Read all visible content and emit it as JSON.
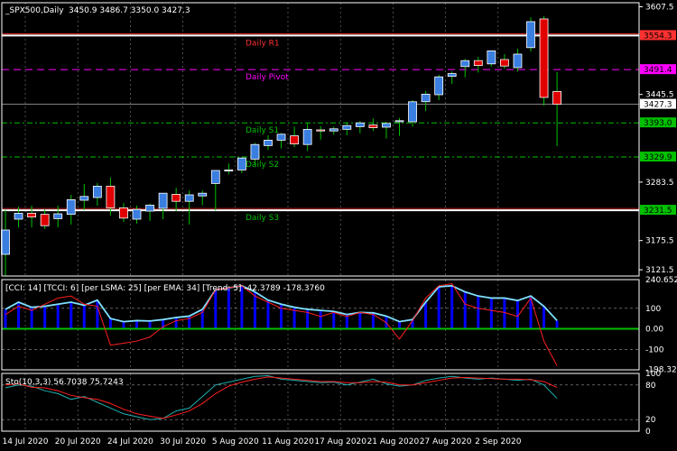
{
  "header": {
    "symbol": "_SPX500,Daily",
    "ohlc": "3450.9 3486.7 3350.0 3427.3"
  },
  "colors": {
    "background": "#000000",
    "grid": "#ffffff",
    "bull": "#3a7ee0",
    "bear": "#e00000",
    "wick": "#00c000",
    "pivot": "#ff00ff",
    "resistance": "#ff3030",
    "support": "#00c000",
    "cci_line": "#7fe0ff",
    "cci_hist": "#0000ff",
    "cci_base": "#00c000",
    "signal_red": "#ff2020",
    "stoch_main": "#1fb0b0",
    "stoch_signal": "#ff2020"
  },
  "chart_data": [
    {
      "type": "candlestick",
      "panel": "main",
      "ylim": [
        3110,
        3615
      ],
      "y_ticks": [
        "3607.5",
        "3445.5",
        "3283.5",
        "3175.5",
        "3121.5"
      ],
      "tick_values": [
        3607.5,
        3445.5,
        3283.5,
        3175.5,
        3121.5
      ],
      "x_labels": [
        "14 Jul 2020",
        "20 Jul 2020",
        "24 Jul 2020",
        "30 Jul 2020",
        "5 Aug 2020",
        "11 Aug 2020",
        "17 Aug 2020",
        "21 Aug 2020",
        "27 Aug 2020",
        "2 Sep 2020"
      ],
      "x_label_index": [
        0,
        4,
        8,
        12,
        16,
        20,
        24,
        28,
        32,
        36
      ],
      "candles": [
        {
          "o": 3150,
          "h": 3232,
          "l": 3110,
          "c": 3195
        },
        {
          "o": 3215,
          "h": 3238,
          "l": 3200,
          "c": 3226
        },
        {
          "o": 3226,
          "h": 3240,
          "l": 3200,
          "c": 3219
        },
        {
          "o": 3224,
          "h": 3233,
          "l": 3197,
          "c": 3203
        },
        {
          "o": 3216,
          "h": 3240,
          "l": 3200,
          "c": 3225
        },
        {
          "o": 3224,
          "h": 3260,
          "l": 3205,
          "c": 3251
        },
        {
          "o": 3250,
          "h": 3280,
          "l": 3232,
          "c": 3257
        },
        {
          "o": 3255,
          "h": 3282,
          "l": 3240,
          "c": 3276
        },
        {
          "o": 3276,
          "h": 3292,
          "l": 3222,
          "c": 3236
        },
        {
          "o": 3236,
          "h": 3245,
          "l": 3210,
          "c": 3217
        },
        {
          "o": 3215,
          "h": 3240,
          "l": 3207,
          "c": 3233
        },
        {
          "o": 3230,
          "h": 3244,
          "l": 3212,
          "c": 3241
        },
        {
          "o": 3235,
          "h": 3262,
          "l": 3215,
          "c": 3263
        },
        {
          "o": 3261,
          "h": 3273,
          "l": 3230,
          "c": 3248
        },
        {
          "o": 3248,
          "h": 3268,
          "l": 3205,
          "c": 3260
        },
        {
          "o": 3258,
          "h": 3268,
          "l": 3241,
          "c": 3263
        },
        {
          "o": 3281,
          "h": 3290,
          "l": 3231,
          "c": 3305
        },
        {
          "o": 3304,
          "h": 3318,
          "l": 3298,
          "c": 3306
        },
        {
          "o": 3306,
          "h": 3330,
          "l": 3300,
          "c": 3328
        },
        {
          "o": 3326,
          "h": 3356,
          "l": 3316,
          "c": 3353
        },
        {
          "o": 3351,
          "h": 3370,
          "l": 3343,
          "c": 3361
        },
        {
          "o": 3361,
          "h": 3374,
          "l": 3346,
          "c": 3372
        },
        {
          "o": 3369,
          "h": 3386,
          "l": 3348,
          "c": 3354
        },
        {
          "o": 3353,
          "h": 3393,
          "l": 3341,
          "c": 3381
        },
        {
          "o": 3380,
          "h": 3387,
          "l": 3362,
          "c": 3378
        },
        {
          "o": 3378,
          "h": 3386,
          "l": 3371,
          "c": 3382
        },
        {
          "o": 3381,
          "h": 3393,
          "l": 3370,
          "c": 3388
        },
        {
          "o": 3386,
          "h": 3396,
          "l": 3374,
          "c": 3393
        },
        {
          "o": 3389,
          "h": 3401,
          "l": 3378,
          "c": 3384
        },
        {
          "o": 3385,
          "h": 3395,
          "l": 3364,
          "c": 3392
        },
        {
          "o": 3395,
          "h": 3402,
          "l": 3369,
          "c": 3397
        },
        {
          "o": 3395,
          "h": 3435,
          "l": 3386,
          "c": 3432
        },
        {
          "o": 3432,
          "h": 3452,
          "l": 3415,
          "c": 3446
        },
        {
          "o": 3445,
          "h": 3482,
          "l": 3435,
          "c": 3478
        },
        {
          "o": 3479,
          "h": 3488,
          "l": 3465,
          "c": 3484
        },
        {
          "o": 3497,
          "h": 3511,
          "l": 3477,
          "c": 3508
        },
        {
          "o": 3508,
          "h": 3515,
          "l": 3486,
          "c": 3499
        },
        {
          "o": 3502,
          "h": 3527,
          "l": 3497,
          "c": 3526
        },
        {
          "o": 3510,
          "h": 3520,
          "l": 3493,
          "c": 3498
        },
        {
          "o": 3495,
          "h": 3530,
          "l": 3488,
          "c": 3520
        },
        {
          "o": 3532,
          "h": 3588,
          "l": 3525,
          "c": 3580
        },
        {
          "o": 3585,
          "h": 3590,
          "l": 3425,
          "c": 3440
        },
        {
          "o": 3450.9,
          "h": 3486.7,
          "l": 3350.0,
          "c": 3427.3
        }
      ],
      "levels": [
        {
          "name": "Daily R1",
          "value": 3554.3,
          "price_label": "3554.3",
          "style": "resistance"
        },
        {
          "name": "Daily Pivot",
          "value": 3491.4,
          "price_label": "3491.4",
          "style": "pivot"
        },
        {
          "name": "",
          "value": 3427.3,
          "price_label": "3427.3",
          "style": "current"
        },
        {
          "name": "Daily S1",
          "value": 3393.0,
          "price_label": "3393.0",
          "style": "support"
        },
        {
          "name": "Daily S2",
          "value": 3329.9,
          "price_label": "3329.9",
          "style": "support"
        },
        {
          "name": "Daily S3",
          "value": 3231.5,
          "price_label": "3231.5",
          "style": "support"
        }
      ]
    },
    {
      "type": "line",
      "panel": "cci",
      "title": "[CCI: 14] [TCCI: 6] [per LSMA: 25] [per EMA: 34] [Trend: 5] -42.3789 -178.3760",
      "ylim": [
        -200,
        240
      ],
      "y_ticks": [
        "240.6524",
        "100",
        "0.00",
        "-100",
        "-198.329"
      ],
      "tick_values": [
        240,
        100,
        0,
        -100,
        -198
      ],
      "series": [
        {
          "values": [
            95,
            130,
            105,
            110,
            120,
            130,
            115,
            140,
            50,
            35,
            40,
            38,
            45,
            55,
            62,
            95,
            190,
            200,
            210,
            180,
            140,
            120,
            105,
            95,
            90,
            85,
            70,
            80,
            78,
            62,
            35,
            45,
            130,
            205,
            210,
            180,
            160,
            150,
            150,
            138,
            160,
            110,
            40
          ]
        },
        {
          "values": [
            70,
            110,
            90,
            120,
            150,
            160,
            120,
            110,
            -80,
            -70,
            -60,
            -40,
            10,
            40,
            50,
            80,
            190,
            200,
            210,
            160,
            130,
            100,
            90,
            80,
            60,
            80,
            60,
            80,
            70,
            30,
            -50,
            40,
            150,
            210,
            220,
            120,
            100,
            90,
            80,
            60,
            150,
            -60,
            -180
          ]
        }
      ]
    },
    {
      "type": "line",
      "panel": "stoch",
      "title": "Sto(10,3,3) 56.7038 75.7243",
      "ylim": [
        0,
        100
      ],
      "y_ticks": [
        "80",
        "100",
        "20",
        "0"
      ],
      "tick_values": [
        80,
        100,
        20,
        0
      ],
      "series": [
        {
          "values": [
            75,
            80,
            78,
            70,
            65,
            55,
            60,
            50,
            40,
            30,
            25,
            20,
            22,
            35,
            40,
            60,
            80,
            85,
            90,
            95,
            96,
            90,
            88,
            86,
            84,
            85,
            80,
            85,
            90,
            82,
            78,
            80,
            88,
            92,
            95,
            92,
            90,
            92,
            90,
            88,
            90,
            80,
            56.7
          ]
        },
        {
          "values": [
            80,
            82,
            76,
            75,
            70,
            62,
            58,
            55,
            48,
            38,
            30,
            26,
            22,
            28,
            35,
            48,
            65,
            78,
            85,
            90,
            94,
            92,
            90,
            88,
            86,
            86,
            84,
            84,
            86,
            85,
            80,
            80,
            84,
            88,
            92,
            93,
            92,
            91,
            90,
            90,
            89,
            86,
            75.7
          ]
        }
      ]
    }
  ]
}
